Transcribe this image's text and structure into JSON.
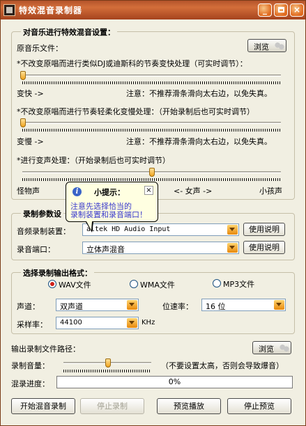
{
  "window": {
    "title": "特效混音录制器",
    "min_label": "_",
    "close_label": "×"
  },
  "effects_group": {
    "title": "对音乐进行特效混音设置：",
    "source_label": "原音乐文件：",
    "browse_label": "浏览",
    "tempo": {
      "desc": "*不改变原唱而进行类似DJ或迪斯科的节奏变快处理（可实时调节）：",
      "left_label": "变快 ->",
      "note": "注意：不推荐滑条滑向太右边，以免失真。",
      "value_fraction": 0.0
    },
    "slow": {
      "desc": "*不改变原唱而进行节奏轻柔化变慢处理：（开始录制后也可实时调节）",
      "left_label": "变慢 ->",
      "note": "注意：不推荐滑条滑向太右边，以免失真。",
      "value_fraction": 0.0
    },
    "pitch": {
      "desc": "*进行变声处理：（开始录制后也可实时调节）",
      "left_label": "怪物声",
      "mid_label": "<- 女声 ->",
      "right_label": "小孩声",
      "value_fraction": 0.5
    }
  },
  "tooltip": {
    "icon": "i",
    "title": "小提示：",
    "close": "×",
    "line1": "注意先选择恰当的",
    "line2": "录制装置和录音端口！"
  },
  "record_params": {
    "title": "录制参数设",
    "device_label": "音频录制装置：",
    "device_value": "altek HD Audio Input",
    "port_label": "录音端口：",
    "port_value": "立体声混音",
    "help_label": "使用说明"
  },
  "output_format": {
    "title": "选择录制输出格式：",
    "options": [
      "WAV文件",
      "WMA文件",
      "MP3文件"
    ],
    "selected": "WAV文件",
    "channel_label": "声道：",
    "channel_value": "双声道",
    "bitrate_label": "位速率：",
    "bitrate_value": "16 位",
    "samplerate_label": "采样率：",
    "samplerate_value": "44100",
    "samplerate_unit": "KHz"
  },
  "output_path": {
    "label": "输出录制文件路径：",
    "browse_label": "浏览"
  },
  "volume": {
    "label": "录制音量：",
    "note": "（不要设置太高，否则会导致爆音）",
    "value_fraction": 0.5
  },
  "progress": {
    "label": "混录进度：",
    "value": "0%"
  },
  "buttons": {
    "start": "开始混音录制",
    "stop": "停止录制",
    "preview_play": "预览播放",
    "preview_stop": "停止预览"
  }
}
